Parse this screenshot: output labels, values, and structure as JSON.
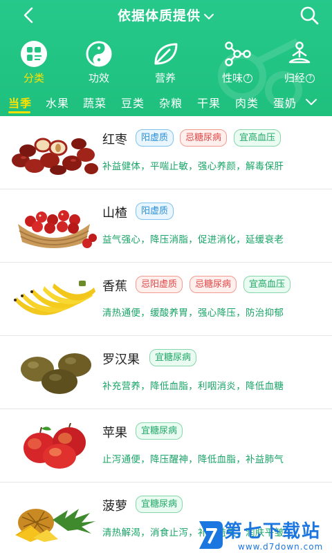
{
  "header": {
    "title": "依据体质提供",
    "categories": [
      {
        "label": "分类",
        "icon": "category-grid-icon",
        "active": true
      },
      {
        "label": "功效",
        "icon": "yin-yang-icon",
        "active": false
      },
      {
        "label": "营养",
        "icon": "leaf-icon",
        "active": false
      },
      {
        "label": "性味",
        "icon": "molecule-icon",
        "active": false,
        "help": "?"
      },
      {
        "label": "归经",
        "icon": "meditation-icon",
        "active": false,
        "help": "?"
      }
    ],
    "seasons": [
      "当季",
      "水果",
      "蔬菜",
      "豆类",
      "杂粮",
      "干果",
      "肉类",
      "蛋奶"
    ],
    "active_season": "当季"
  },
  "colors": {
    "header_green": "#22c584",
    "active_yellow": "#ffe100",
    "desc_green": "#19a467"
  },
  "items": [
    {
      "name": "红枣",
      "image": "red-dates",
      "tags": [
        {
          "text": "阳虚质",
          "color": "blue"
        },
        {
          "text": "忌糖尿病",
          "color": "red"
        },
        {
          "text": "宜高血压",
          "color": "green"
        }
      ],
      "desc": "补益健体，平喘止敏，强心养颜，解毒保肝"
    },
    {
      "name": "山楂",
      "image": "hawthorn",
      "tags": [
        {
          "text": "阳虚质",
          "color": "blue"
        }
      ],
      "desc": "益气强心，降压消脂，促进消化，延缓衰老"
    },
    {
      "name": "香蕉",
      "image": "banana",
      "tags": [
        {
          "text": "忌阳虚质",
          "color": "red"
        },
        {
          "text": "忌糖尿病",
          "color": "red"
        },
        {
          "text": "宜高血压",
          "color": "green"
        }
      ],
      "desc": "清热通便，缓酸养胃，强心降压，防治抑郁"
    },
    {
      "name": "罗汉果",
      "image": "monk-fruit",
      "tags": [
        {
          "text": "宜糖尿病",
          "color": "green"
        }
      ],
      "desc": "补充营养，降低血脂，利咽消炎，降低血糖"
    },
    {
      "name": "苹果",
      "image": "apple",
      "tags": [
        {
          "text": "宜糖尿病",
          "color": "green"
        }
      ],
      "desc": "止泻通便，降压醒神，降低血脂，补益肺气"
    },
    {
      "name": "菠萝",
      "image": "pineapple",
      "tags": [
        {
          "text": "宜糖尿病",
          "color": "green"
        }
      ],
      "desc": "清热解渴，消食止泻，补血益气，润肤平皱"
    }
  ],
  "watermark": {
    "text": "第七下载站",
    "url": "www.d7down.com"
  }
}
